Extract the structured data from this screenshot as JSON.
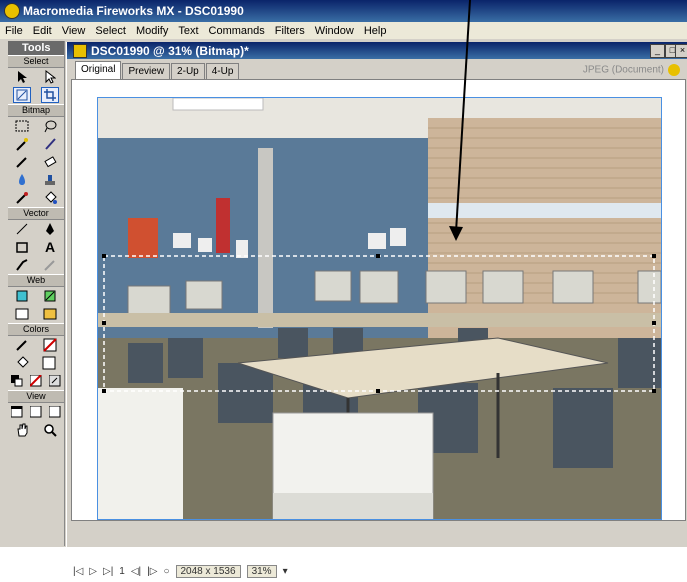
{
  "app": {
    "title": "Macromedia Fireworks MX - DSC01990",
    "menu": [
      "File",
      "Edit",
      "View",
      "Select",
      "Modify",
      "Text",
      "Commands",
      "Filters",
      "Window",
      "Help"
    ]
  },
  "tools_panel": {
    "title": "Tools",
    "sections": [
      "Select",
      "Bitmap",
      "Vector",
      "Web",
      "Colors",
      "View"
    ]
  },
  "document": {
    "title": "DSC01990 @  31% (Bitmap)*",
    "tabs": [
      "Original",
      "Preview",
      "2-Up",
      "4-Up"
    ],
    "format_label": "JPEG (Document)",
    "status": {
      "frame": "1",
      "dimensions": "2048 x 1536",
      "zoom": "31%"
    }
  },
  "colors": {
    "title_bar": "#0a246a",
    "selection": "#ffffff"
  },
  "icons": [
    "pointer-icon",
    "subselect-icon",
    "scale-icon",
    "crop-icon",
    "marquee-icon",
    "lasso-icon",
    "magic-wand-icon",
    "brush-icon",
    "pencil-icon",
    "eraser-icon",
    "blur-icon",
    "rubber-stamp-icon",
    "eyedropper-icon",
    "paint-bucket-icon",
    "line-icon",
    "pen-icon",
    "rectangle-icon",
    "text-icon",
    "knife-icon",
    "hotspot-icon",
    "slice-icon",
    "stroke-color-icon",
    "fill-color-icon",
    "hand-icon",
    "zoom-icon"
  ]
}
